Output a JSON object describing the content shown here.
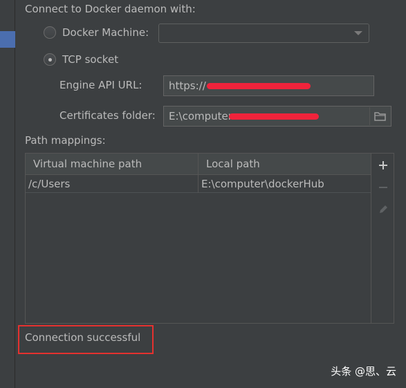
{
  "section": {
    "connect_title": "Connect to Docker daemon with:",
    "docker_machine_label": "Docker Machine:",
    "docker_machine_value": "",
    "tcp_socket_label": "TCP socket",
    "selected": "TCP socket"
  },
  "fields": {
    "engine_api_label": "Engine API URL:",
    "engine_api_value": "https://",
    "certificates_label": "Certificates folder:",
    "certificates_value": "E:\\computer"
  },
  "path_mappings": {
    "title": "Path mappings:",
    "columns": [
      "Virtual machine path",
      "Local path"
    ],
    "rows": [
      [
        "/c/Users",
        "E:\\computer\\dockerHub"
      ]
    ]
  },
  "toolbar": {
    "add_icon": "plus-icon",
    "remove_icon": "minus-icon",
    "edit_icon": "pencil-icon"
  },
  "status": {
    "message": "Connection successful"
  },
  "watermark": {
    "text": "头条 @思、云"
  },
  "colors": {
    "background": "#3c3f41",
    "text": "#bbbbbb",
    "selection": "#4b6eaf",
    "highlight_border": "#e5312f",
    "redaction": "#f0233b"
  }
}
